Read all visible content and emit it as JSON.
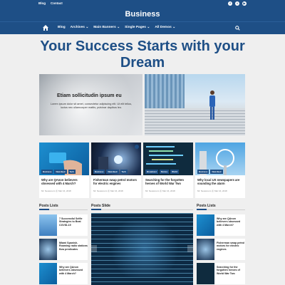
{
  "topbar": {
    "links": [
      "Blog",
      "Contact"
    ]
  },
  "brand": {
    "name": "Business"
  },
  "nav": {
    "items": [
      "Blog",
      "Archives ⌄",
      "Main Banners ⌄",
      "Single Pages ⌄",
      "All Demos ⌄"
    ]
  },
  "headline": "Your Success Starts with your Dream",
  "hero": {
    "title": "Etiam sollicitudin ipsum eu",
    "text": "Lorem ipsum dolor sit amet, consectetur adipiscing elit. Ut elit tellus, luctus nec ullamcorper mattis, pulvinar dapibus leo."
  },
  "cards": [
    {
      "tags": [
        "Business",
        "Newsfeed",
        "Tech"
      ],
      "title": "Why are QAnon believers obsessed with 4 March?",
      "meta": "Mr. Newsroom  ⦿ Mar 16, 2018"
    },
    {
      "tags": [
        "Business",
        "Newsfeed",
        "Tech"
      ],
      "title": "Fisherman swap petrol motors for electric engines",
      "meta": "Mr. Newsroom  ⦿ Mar 16, 2018"
    },
    {
      "tags": [
        "Broadcast",
        "Stories",
        "World"
      ],
      "title": "Searching for the forgotten heroes of World War Two",
      "meta": "Mr. Newsroom  ⦿ Mar 16, 2018"
    },
    {
      "tags": [
        "Business",
        "Newsfeed"
      ],
      "title": "Why local US newspapers are sounding the alarm",
      "meta": "Mr. Newsroom  ⦿ Mar 16, 2018"
    }
  ],
  "sections": {
    "left": "Posts Lists",
    "middle": "Posts Slide",
    "right": "Posts Lists"
  },
  "left_posts": [
    {
      "title": "7 Successful Selfie Strategies to Beat COVID-19"
    },
    {
      "title": "Miami Spanish-Roaming radio stations flow predicates"
    },
    {
      "title": "Why are QAnon believers obsessed with 4 March?"
    }
  ],
  "right_posts": [
    {
      "title": "Why are QAnon believers obsessed with 4 March?"
    },
    {
      "title": "Fisherman swap petrol motors for electric engines"
    },
    {
      "title": "Searching for the forgotten heroes of World War Two"
    }
  ],
  "colors": {
    "brand": "#1e4f86",
    "background": "#efefef"
  }
}
